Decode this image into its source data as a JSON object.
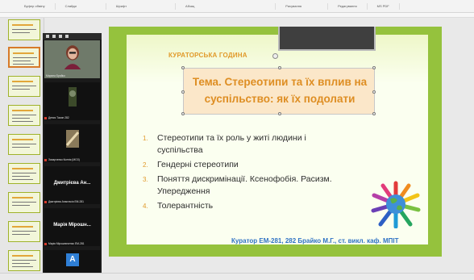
{
  "ribbon": {
    "groups": [
      "Буфер обміну",
      "Слайди",
      "Шрифт",
      "Абзац",
      "Рисування",
      "Редагування",
      "MS PDF"
    ]
  },
  "thumbnails": {
    "count": 9,
    "selected_index": 1
  },
  "zoom": {
    "participants": [
      {
        "name": "Марина Брайко",
        "kind": "video"
      },
      {
        "name": "Денис Тасин 282",
        "kind": "video"
      },
      {
        "name": "Захарченко Ксенія (МОЗ)",
        "kind": "video"
      },
      {
        "name": "Дмитрієва Анастасія ЕМ-281",
        "short": "Дмитрієва Ан...",
        "kind": "name"
      },
      {
        "name": "Марія Мірошниченко ЕМ-281",
        "short": "Марія Мірошн...",
        "kind": "name"
      },
      {
        "name": "Анна Полтавець ЕМ-281",
        "kind": "avatar",
        "letter": "А"
      }
    ]
  },
  "slide": {
    "kicker": "КУРАТОРСЬКА ГОДИНА",
    "title_line1": "Тема. Стереотипи та їх вплив на",
    "title_line2": "суспільство: як їх подолати",
    "items": [
      {
        "num": "1.",
        "line1": "Стереотипи та їх роль у житі людини і",
        "line2": "суспільства"
      },
      {
        "num": "2.",
        "line1": "Гендерні стереотипи",
        "line2": ""
      },
      {
        "num": "3.",
        "line1": "Поняття дискримінації. Ксенофобія. Расизм.",
        "line2": "Упередження"
      },
      {
        "num": "4.",
        "line1": "Толерантність",
        "line2": ""
      }
    ],
    "footer": "Куратор ЕМ-281, 282  Брайко М.Г., ст. викл. каф. МПІТ"
  },
  "colors": {
    "slide_border": "#95c23d",
    "accent_orange": "#de8e23",
    "footer_blue": "#2f72c4"
  }
}
